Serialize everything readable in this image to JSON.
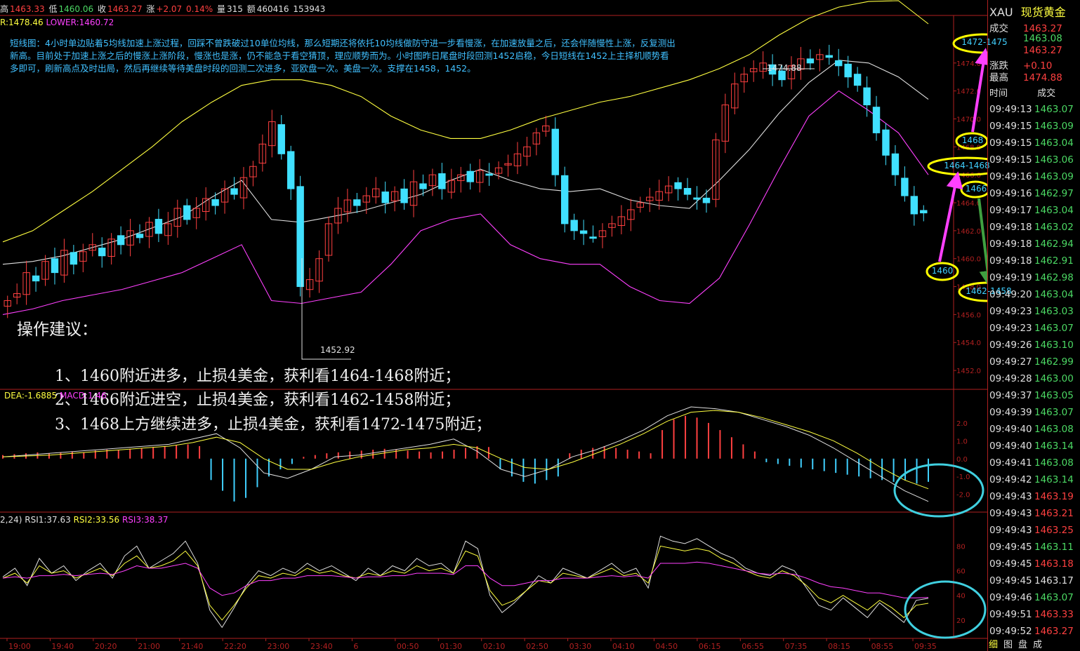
{
  "header": {
    "high_label": "高",
    "high": "1463.33",
    "low_label": "低",
    "low": "1460.06",
    "close_label": "收",
    "close": "1463.27",
    "change_label": "涨",
    "change": "+2.07",
    "change_pct": "0.14%",
    "volume_label": "量",
    "volume": "315",
    "amount_label": "额",
    "amount": "460416",
    "extra": "153943"
  },
  "boll": {
    "upper": "R:1478.46",
    "lower": "LOWER:1460.72"
  },
  "note": "短线图：4小时单边贴着5均线加速上涨过程，回踩不曾跌破过10单位均线，那么短期还将依托10均线做防守进一步看慢涨，在加速放量之后，还会伴随慢性上涨，反复测出新高。目前处于加速上涨之后的慢涨上涨阶段，慢涨也是涨，仍不能急于看空猜顶，理应顺势而为。小时图昨日尾盘时段回测1452启稳，今日短线在1452上主择机顺势看多即可，刷新高点及时出局，然后再继续等待美盘时段的回测二次进多，亚欧盘一次。美盘一次。支撑在1458，1452。",
  "advice": {
    "title": "操作建议：",
    "lines": [
      "1、1460附近进多，止损4美金，获利看1464-1468附近；",
      "2、1466附近进空，止损4美金，获利看1462-1458附近；",
      "3、1468上方继续进多，止损4美金，获利看1472-1475附近；"
    ]
  },
  "macd_header": {
    "dea": "DEA:-1.6885",
    "macd": "MACD:1.46"
  },
  "rsi_header": {
    "params": "2,24)",
    "rsi1": "RSI1:37.63",
    "rsi2": "RSI2:33.56",
    "rsi3": "RSI3:38.37"
  },
  "annotations": {
    "target_high": "1472-1475",
    "level_1468": "1468",
    "target_mid": "1464-1468",
    "level_1466": "1466",
    "level_1460": "1460",
    "target_low": "1462-1458",
    "high_mark": "1474.88",
    "low_mark": "1452.92"
  },
  "sidebar": {
    "symbol": "XAU",
    "name": "现货黄金",
    "quote": [
      {
        "label": "成交",
        "value": "1463.27",
        "color": "#ff4040"
      },
      {
        "label": "",
        "value": "1463.08",
        "color": "#4cd964"
      },
      {
        "label": "",
        "value": "1463.27",
        "color": "#ff4040"
      },
      {
        "label": "涨跌",
        "value": "+0.10",
        "color": "#ff4040"
      },
      {
        "label": "最高",
        "value": "1474.88",
        "color": "#ff4040"
      }
    ],
    "ticks_header": {
      "time": "时间",
      "price": "成交"
    },
    "ticks": [
      {
        "t": "09:49:13",
        "p": "1463.07",
        "c": "#4cd964"
      },
      {
        "t": "09:49:15",
        "p": "1463.09",
        "c": "#4cd964"
      },
      {
        "t": "09:49:15",
        "p": "1463.04",
        "c": "#4cd964"
      },
      {
        "t": "09:49:15",
        "p": "1463.06",
        "c": "#4cd964"
      },
      {
        "t": "09:49:16",
        "p": "1463.09",
        "c": "#4cd964"
      },
      {
        "t": "09:49:16",
        "p": "1462.97",
        "c": "#4cd964"
      },
      {
        "t": "09:49:17",
        "p": "1463.04",
        "c": "#4cd964"
      },
      {
        "t": "09:49:18",
        "p": "1463.02",
        "c": "#4cd964"
      },
      {
        "t": "09:49:18",
        "p": "1462.94",
        "c": "#4cd964"
      },
      {
        "t": "09:49:18",
        "p": "1462.91",
        "c": "#4cd964"
      },
      {
        "t": "09:49:19",
        "p": "1462.98",
        "c": "#4cd964"
      },
      {
        "t": "09:49:20",
        "p": "1463.04",
        "c": "#4cd964"
      },
      {
        "t": "09:49:23",
        "p": "1463.03",
        "c": "#4cd964"
      },
      {
        "t": "09:49:23",
        "p": "1463.07",
        "c": "#4cd964"
      },
      {
        "t": "09:49:26",
        "p": "1463.10",
        "c": "#4cd964"
      },
      {
        "t": "09:49:27",
        "p": "1462.99",
        "c": "#4cd964"
      },
      {
        "t": "09:49:28",
        "p": "1463.00",
        "c": "#4cd964"
      },
      {
        "t": "09:49:37",
        "p": "1463.05",
        "c": "#4cd964"
      },
      {
        "t": "09:49:39",
        "p": "1463.07",
        "c": "#4cd964"
      },
      {
        "t": "09:49:40",
        "p": "1463.08",
        "c": "#4cd964"
      },
      {
        "t": "09:49:40",
        "p": "1463.14",
        "c": "#4cd964"
      },
      {
        "t": "09:49:41",
        "p": "1463.08",
        "c": "#4cd964"
      },
      {
        "t": "09:49:42",
        "p": "1463.14",
        "c": "#4cd964"
      },
      {
        "t": "09:49:43",
        "p": "1463.19",
        "c": "#ff4040"
      },
      {
        "t": "09:49:43",
        "p": "1463.21",
        "c": "#ff4040"
      },
      {
        "t": "09:49:43",
        "p": "1463.25",
        "c": "#ff4040"
      },
      {
        "t": "09:49:45",
        "p": "1463.11",
        "c": "#4cd964"
      },
      {
        "t": "09:49:45",
        "p": "1463.18",
        "c": "#ff4040"
      },
      {
        "t": "09:49:45",
        "p": "1463.17",
        "c": "#e0e0e0"
      },
      {
        "t": "09:49:46",
        "p": "1463.07",
        "c": "#4cd964"
      },
      {
        "t": "09:49:51",
        "p": "1463.33",
        "c": "#ff4040"
      },
      {
        "t": "09:49:52",
        "p": "1463.27",
        "c": "#ff4040"
      }
    ],
    "tabs": [
      "细",
      "图",
      "盘",
      "成"
    ]
  },
  "chart_data": [
    {
      "type": "candlestick",
      "title": "",
      "y_ticks": [
        1452.0,
        1454.0,
        1456.0,
        1458.0,
        1460.0,
        1462.0,
        1464.0,
        1466.0,
        1468.0,
        1470.0,
        1472.0,
        1474.0
      ],
      "ylim": [
        1451.0,
        1476.5
      ],
      "x_ticks": [
        "19:00",
        "19:40",
        "20:20",
        "21:00",
        "21:40",
        "22:20",
        "23:00",
        "23:40",
        "6",
        "00:50",
        "01:30",
        "02:10",
        "02:50",
        "03:30",
        "04:10",
        "04:50",
        "06:15",
        "06:55",
        "07:35",
        "08:15",
        "08:55",
        "09:35"
      ],
      "grid": false,
      "closes": [
        1457.0,
        1457.5,
        1459.0,
        1458.4,
        1459.8,
        1459.0,
        1460.6,
        1459.6,
        1460.5,
        1461.0,
        1460.2,
        1461.4,
        1461.0,
        1462.0,
        1461.5,
        1462.6,
        1461.8,
        1462.5,
        1463.6,
        1462.8,
        1463.6,
        1464.3,
        1463.8,
        1465.0,
        1464.6,
        1465.8,
        1466.6,
        1468.2,
        1469.8,
        1467.5,
        1465.0,
        1458.0,
        1458.5,
        1460.0,
        1462.5,
        1463.6,
        1464.2,
        1463.8,
        1464.5,
        1465.0,
        1464.0,
        1464.8,
        1464.0,
        1465.5,
        1465.0,
        1466.0,
        1465.0,
        1465.6,
        1466.0,
        1465.5,
        1466.3,
        1466.0,
        1466.5,
        1466.8,
        1467.5,
        1468.0,
        1469.0,
        1469.5,
        1466.0,
        1462.5,
        1462.0,
        1461.8,
        1461.5,
        1462.0,
        1462.5,
        1463.0,
        1463.5,
        1464.0,
        1464.4,
        1464.8,
        1465.2,
        1465.0,
        1464.6,
        1464.3,
        1464.0,
        1468.5,
        1471.0,
        1472.5,
        1473.2,
        1473.6,
        1474.0,
        1473.2,
        1472.8,
        1473.8,
        1474.3,
        1474.0,
        1474.6,
        1474.4,
        1473.8,
        1473.0,
        1472.4,
        1471.0,
        1469.0,
        1467.4,
        1466.0,
        1464.5,
        1463.2,
        1463.27
      ],
      "series": [
        {
          "name": "UPPER",
          "color": "#ffff40",
          "values": [
            1461.2,
            1462.0,
            1463.4,
            1464.8,
            1466.4,
            1468.0,
            1469.8,
            1471.2,
            1472.4,
            1472.8,
            1472.8,
            1472.4,
            1471.6,
            1470.2,
            1469.2,
            1468.6,
            1468.6,
            1469.2,
            1470.0,
            1470.6,
            1471.2,
            1471.6,
            1472.2,
            1472.8,
            1473.6,
            1474.6,
            1476.0,
            1477.2,
            1478.0,
            1478.4,
            1478.46,
            1476.8
          ]
        },
        {
          "name": "MID",
          "color": "#e0e0e0",
          "values": [
            1459.6,
            1459.8,
            1460.2,
            1460.8,
            1461.4,
            1462.2,
            1463.0,
            1464.4,
            1465.6,
            1462.8,
            1462.6,
            1463.0,
            1463.4,
            1464.0,
            1464.6,
            1465.6,
            1466.4,
            1465.6,
            1465.0,
            1464.8,
            1465.0,
            1464.2,
            1463.8,
            1463.6,
            1465.6,
            1467.8,
            1470.4,
            1472.6,
            1474.2,
            1474.0,
            1473.0,
            1471.4
          ]
        },
        {
          "name": "LOWER",
          "color": "#ff40ff",
          "values": [
            1456.0,
            1456.4,
            1457.0,
            1457.4,
            1457.8,
            1458.4,
            1459.0,
            1460.0,
            1461.0,
            1457.0,
            1456.8,
            1457.2,
            1457.6,
            1459.6,
            1462.0,
            1462.8,
            1463.2,
            1461.0,
            1460.0,
            1459.6,
            1459.6,
            1458.0,
            1457.0,
            1456.8,
            1458.6,
            1462.4,
            1466.4,
            1470.2,
            1472.0,
            1470.6,
            1469.0,
            1466.0
          ]
        }
      ]
    },
    {
      "type": "bar",
      "title": "",
      "y_ticks": [
        -2.0,
        -1.0,
        0.0,
        1.0,
        2.0
      ],
      "ylim": [
        -2.8,
        2.9
      ],
      "macd_hist": [
        0.2,
        0.25,
        0.3,
        0.35,
        0.3,
        0.35,
        0.4,
        0.35,
        0.45,
        0.5,
        0.5,
        0.55,
        0.6,
        0.65,
        0.7,
        0.75,
        0.8,
        0.7,
        -1.2,
        -1.8,
        -2.4,
        -2.2,
        -1.6,
        -1.0,
        -0.6,
        -0.3,
        0.1,
        0.2,
        0.3,
        0.35,
        0.4,
        0.45,
        0.5,
        0.55,
        0.5,
        0.45,
        0.4,
        0.35,
        0.4,
        0.5,
        0.6,
        0.7,
        0.65,
        -0.6,
        -1.0,
        -1.3,
        -1.4,
        -1.2,
        -1.0,
        0.3,
        0.5,
        0.6,
        0.7,
        0.6,
        0.5,
        0.4,
        0.3,
        1.6,
        2.2,
        2.4,
        2.3,
        2.0,
        1.6,
        1.2,
        0.8,
        0.4,
        -0.2,
        -0.3,
        -0.4,
        -0.5,
        -0.6,
        -0.7,
        -0.8,
        -0.9,
        -1.0,
        -1.1,
        -1.2,
        -1.3,
        -1.2,
        -1.4,
        -1.3
      ],
      "dif": [
        0.1,
        0.2,
        0.3,
        0.4,
        0.5,
        0.6,
        0.7,
        0.8,
        1.1,
        1.4,
        0.6,
        -0.8,
        -1.1,
        -0.6,
        0.1,
        0.2,
        0.4,
        0.6,
        0.8,
        1.1,
        0.4,
        -0.6,
        -1.0,
        -0.6,
        0.1,
        0.5,
        1.0,
        1.6,
        2.4,
        2.9,
        2.8,
        2.6,
        2.2,
        1.8,
        1.3,
        0.6,
        -0.2,
        -1.0,
        -1.8,
        -2.4
      ],
      "dea": [
        0.1,
        0.15,
        0.2,
        0.3,
        0.4,
        0.5,
        0.6,
        0.7,
        0.9,
        1.2,
        0.9,
        0.0,
        -0.6,
        -0.6,
        -0.2,
        0.1,
        0.3,
        0.5,
        0.6,
        0.8,
        0.6,
        0.0,
        -0.5,
        -0.6,
        -0.2,
        0.3,
        0.8,
        1.4,
        2.1,
        2.6,
        2.7,
        2.6,
        2.3,
        1.9,
        1.5,
        1.0,
        0.3,
        -0.5,
        -1.2,
        -1.6885
      ]
    },
    {
      "type": "line",
      "title": "",
      "y_ticks": [
        20,
        40,
        60,
        80
      ],
      "ylim": [
        8,
        95
      ],
      "series": [
        {
          "name": "RSI1",
          "color": "#e0e0e0",
          "values": [
            55,
            62,
            48,
            70,
            58,
            64,
            52,
            60,
            66,
            54,
            72,
            80,
            62,
            68,
            74,
            84,
            66,
            28,
            14,
            30,
            48,
            60,
            56,
            62,
            58,
            66,
            60,
            64,
            58,
            52,
            62,
            56,
            64,
            60,
            70,
            64,
            66,
            58,
            84,
            78,
            40,
            26,
            34,
            44,
            56,
            50,
            62,
            58,
            54,
            60,
            66,
            58,
            62,
            46,
            88,
            84,
            82,
            86,
            80,
            74,
            70,
            62,
            58,
            56,
            64,
            60,
            46,
            32,
            28,
            38,
            30,
            22,
            34,
            26,
            18,
            36,
            37.63
          ]
        },
        {
          "name": "RSI2",
          "color": "#ffff40",
          "values": [
            54,
            58,
            50,
            64,
            58,
            60,
            54,
            58,
            62,
            56,
            66,
            72,
            62,
            64,
            68,
            76,
            64,
            32,
            20,
            32,
            46,
            56,
            54,
            58,
            56,
            62,
            58,
            60,
            56,
            54,
            58,
            56,
            60,
            58,
            64,
            60,
            62,
            58,
            76,
            72,
            44,
            32,
            36,
            44,
            52,
            50,
            58,
            56,
            54,
            58,
            62,
            56,
            58,
            50,
            80,
            78,
            76,
            78,
            76,
            70,
            66,
            60,
            56,
            54,
            60,
            56,
            48,
            38,
            34,
            40,
            34,
            28,
            36,
            30,
            22,
            32,
            33.56
          ]
        },
        {
          "name": "RSI3",
          "color": "#ff40ff",
          "values": [
            54,
            55,
            54,
            56,
            56,
            57,
            56,
            57,
            58,
            57,
            60,
            64,
            62,
            62,
            64,
            66,
            62,
            46,
            40,
            42,
            48,
            52,
            52,
            54,
            54,
            56,
            56,
            56,
            55,
            54,
            55,
            55,
            56,
            56,
            58,
            58,
            58,
            57,
            64,
            64,
            54,
            48,
            48,
            50,
            52,
            52,
            54,
            54,
            54,
            55,
            56,
            55,
            56,
            54,
            66,
            66,
            66,
            67,
            66,
            64,
            62,
            60,
            58,
            57,
            58,
            57,
            54,
            50,
            47,
            46,
            44,
            42,
            42,
            40,
            38,
            38,
            38.37
          ]
        }
      ]
    }
  ]
}
